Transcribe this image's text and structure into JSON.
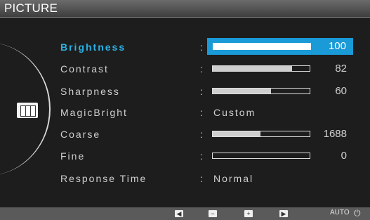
{
  "title": "PICTURE",
  "items": [
    {
      "label": "Brightness",
      "value": "100",
      "level": 100
    },
    {
      "label": "Contrast",
      "value": "82",
      "level": 82
    },
    {
      "label": "Sharpness",
      "value": "60",
      "level": 60
    },
    {
      "label": "MagicBright",
      "value": "Custom"
    },
    {
      "label": "Coarse",
      "value": "1688",
      "level": 49
    },
    {
      "label": "Fine",
      "value": "0",
      "level": 0
    },
    {
      "label": "Response Time",
      "value": "Normal"
    }
  ],
  "bottom": {
    "left_icon": "left-triangle-icon",
    "minus_icon": "minus-icon",
    "plus_icon": "plus-icon",
    "right_icon": "right-triangle-icon",
    "auto_label": "AUTO",
    "power_icon": "power-icon"
  }
}
